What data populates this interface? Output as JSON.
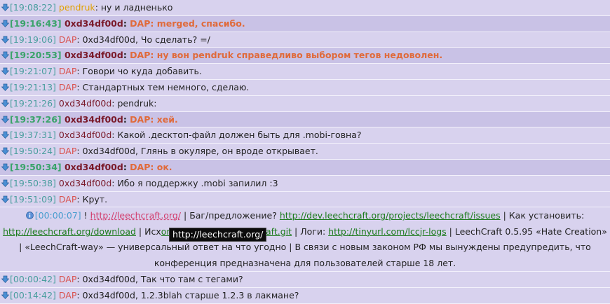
{
  "messages": [
    {
      "ts": "[19:08:22]",
      "nick": "pendruk",
      "nick_class": "pendruk",
      "text": "ну и ладненько",
      "highlight": false
    },
    {
      "ts": "[19:16:43]",
      "nick": "0xd34df00d",
      "nick_class": "me",
      "text": "DAP: merged, спасибо.",
      "highlight": true
    },
    {
      "ts": "[19:19:06]",
      "nick": "DAP",
      "nick_class": "dap",
      "text": "0xd34df00d, Чо сделать? =/",
      "highlight": false
    },
    {
      "ts": "[19:20:53]",
      "nick": "0xd34df00d",
      "nick_class": "me",
      "text": "DAP: ну вон pendruk справедливо выбором тегов недоволен.",
      "highlight": true
    },
    {
      "ts": "[19:21:07]",
      "nick": "DAP",
      "nick_class": "dap",
      "text": "Говори чо куда добавить.",
      "highlight": false
    },
    {
      "ts": "[19:21:13]",
      "nick": "DAP",
      "nick_class": "dap",
      "text": "Стандартных тем немного, сделаю.",
      "highlight": false
    },
    {
      "ts": "[19:21:26]",
      "nick": "0xd34df00d",
      "nick_class": "me",
      "text": "pendruk:",
      "highlight": false
    },
    {
      "ts": "[19:37:26]",
      "nick": "0xd34df00d",
      "nick_class": "me",
      "text": "DAP: хей.",
      "highlight": true
    },
    {
      "ts": "[19:37:31]",
      "nick": "0xd34df00d",
      "nick_class": "me",
      "text": "Какой .десктоп-файл должен быть для .mobi-говна?",
      "highlight": false
    },
    {
      "ts": "[19:50:24]",
      "nick": "DAP",
      "nick_class": "dap",
      "text": "0xd34df00d, Глянь в окуляре, он вроде открывает.",
      "highlight": false
    },
    {
      "ts": "[19:50:34]",
      "nick": "0xd34df00d",
      "nick_class": "me",
      "text": "DAP: ок.",
      "highlight": true
    },
    {
      "ts": "[19:50:38]",
      "nick": "0xd34df00d",
      "nick_class": "me",
      "text": "Ибо я поддержку .mobi запилил :3",
      "highlight": false
    },
    {
      "ts": "[19:51:09]",
      "nick": "DAP",
      "nick_class": "dap",
      "text": "Крут.",
      "highlight": false
    }
  ],
  "topic": {
    "ts": "[00:00:07]",
    "prefix": "!",
    "link1": "http://leechcraft.org/",
    "t1": "| Баг/предложение?",
    "link2": "http://dev.leechcraft.org/projects/leechcraft/issues",
    "t2": "| Как установить:",
    "link3": "http://leechcraft.org/download",
    "t3": "| Исх",
    "link4": "om/0xd34df00d/leechcraft.git",
    "t4": "| Логи:",
    "link5": "http://tinyurl.com/lccjr-logs",
    "t5": "| LeechCraft 0.5.95 «Hate Creation» | «LeechCraft-way» — универсальный ответ на что угодно | В связи с новым законом РФ мы вынуждены предупредить, что конференция предназначена для пользователей старше 18 лет."
  },
  "tooltip": "http://leechcraft.org/",
  "messages_after": [
    {
      "ts": "[00:00:42]",
      "nick": "DAP",
      "nick_class": "dap",
      "text": "0xd34df00d, Так что там с тегами?",
      "highlight": false
    },
    {
      "ts": "[00:14:42]",
      "nick": "DAP",
      "nick_class": "dap",
      "text": "0xd34df00d, 1.2.3blah старше 1.2.3 в лакмане?",
      "highlight": false
    }
  ],
  "colors": {
    "background": "#d8d2ee",
    "highlight_row": "#c9c2e6",
    "link": "#1a7a1a",
    "nick_dap": "#d9534f",
    "nick_pendruk": "#e0a000",
    "nick_me": "#7a1a2a"
  }
}
